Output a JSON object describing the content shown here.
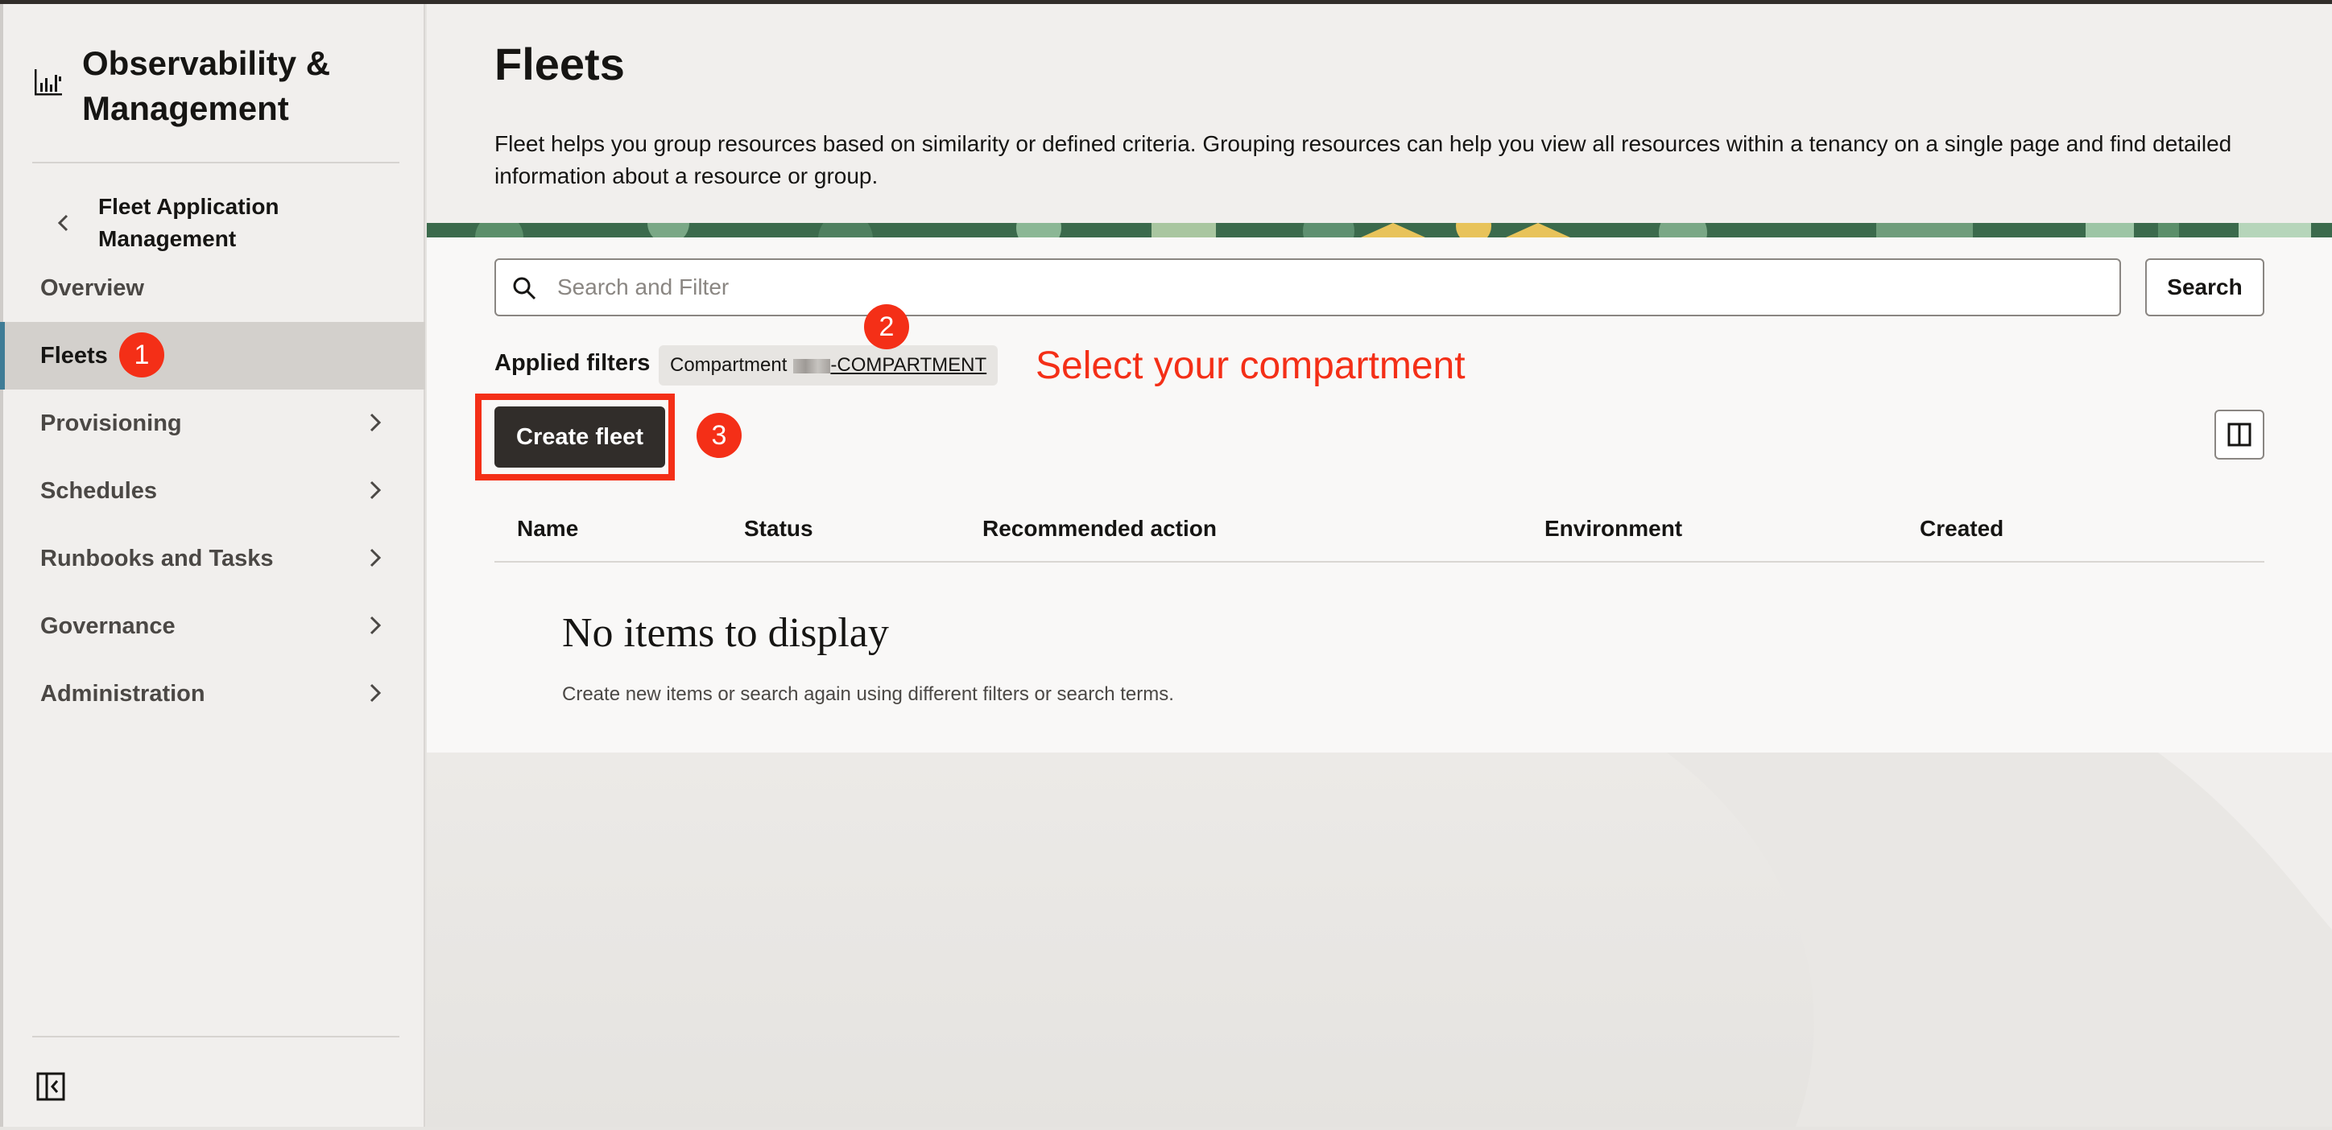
{
  "sidebar": {
    "brand_title": "Observability & Management",
    "back_label": "Fleet Application Management",
    "items": [
      {
        "label": "Overview",
        "selected": false,
        "has_children": false
      },
      {
        "label": "Fleets",
        "selected": true,
        "has_children": false
      },
      {
        "label": "Provisioning",
        "selected": false,
        "has_children": true
      },
      {
        "label": "Schedules",
        "selected": false,
        "has_children": true
      },
      {
        "label": "Runbooks and Tasks",
        "selected": false,
        "has_children": true
      },
      {
        "label": "Governance",
        "selected": false,
        "has_children": true
      },
      {
        "label": "Administration",
        "selected": false,
        "has_children": true
      }
    ],
    "icons": {
      "brand": "chart-icon",
      "back": "chevron-left-icon",
      "collapse": "collapse-sidebar-icon"
    }
  },
  "header": {
    "title": "Fleets",
    "description": "Fleet helps you group resources based on similarity or defined criteria. Grouping resources can help you view all resources within a tenancy on a single page and find detailed information about a resource or group."
  },
  "search": {
    "placeholder": "Search and Filter",
    "button_label": "Search"
  },
  "filters": {
    "label": "Applied filters",
    "chip_key": "Compartment",
    "chip_value_suffix": "-COMPARTMENT"
  },
  "actions": {
    "create_label": "Create fleet"
  },
  "table": {
    "columns": [
      "Name",
      "Status",
      "Recommended action",
      "Environment",
      "Created"
    ],
    "rows": [],
    "empty_title": "No items to display",
    "empty_message": "Create new items or search again using different filters or search terms."
  },
  "annotations": {
    "markers": [
      "1",
      "2",
      "3"
    ],
    "callout": "Select your compartment",
    "color": "#f42f17"
  },
  "colors": {
    "primary_button": "#312d2a",
    "selected_nav": "#d3d0cc",
    "selected_accent": "#3f7c96"
  }
}
